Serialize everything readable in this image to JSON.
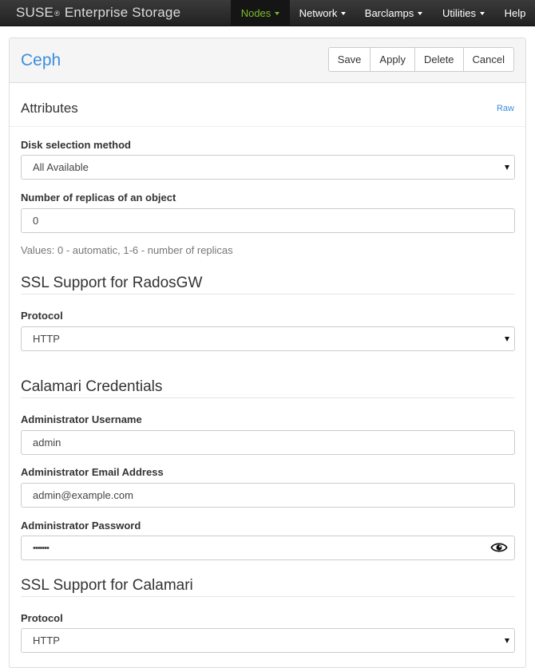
{
  "navbar": {
    "brand": "SUSE",
    "brand_reg": "®",
    "brand_rest": "Enterprise Storage",
    "items": [
      {
        "label": "Nodes"
      },
      {
        "label": "Network"
      },
      {
        "label": "Barclamps"
      },
      {
        "label": "Utilities"
      },
      {
        "label": "Help"
      }
    ],
    "active_color": "#7dbb2f"
  },
  "panel": {
    "title": "Ceph",
    "buttons": {
      "save": "Save",
      "apply": "Apply",
      "delete": "Delete",
      "cancel": "Cancel"
    }
  },
  "attributes": {
    "title": "Attributes",
    "raw_link": "Raw"
  },
  "form": {
    "disk_selection": {
      "label": "Disk selection method",
      "value": "All Available"
    },
    "replicas": {
      "label": "Number of replicas of an object",
      "value": "0",
      "help": "Values: 0 - automatic, 1-6 - number of replicas"
    },
    "ssl_radosgw": {
      "title": "SSL Support for RadosGW",
      "protocol_label": "Protocol",
      "protocol_value": "HTTP"
    },
    "calamari": {
      "title": "Calamari Credentials",
      "username_label": "Administrator Username",
      "username_value": "admin",
      "email_label": "Administrator Email Address",
      "email_value": "admin@example.com",
      "password_label": "Administrator Password",
      "password_value": "•••••••"
    },
    "ssl_calamari": {
      "title": "SSL Support for Calamari",
      "protocol_label": "Protocol",
      "protocol_value": "HTTP"
    }
  },
  "colors": {
    "link": "#3e8ddd",
    "navbar_bg": "#2a2a2a"
  }
}
